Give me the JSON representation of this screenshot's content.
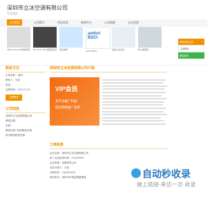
{
  "header": {
    "title": "深圳市立冰空调有限公司",
    "subtitle": "今天您好"
  },
  "nav": {
    "items": [
      "公司首页",
      "公司简介",
      "供应信息",
      "新闻中心",
      "公司相册",
      "企业资质"
    ],
    "active_index": 0
  },
  "thumbs": [
    {
      "caption": "GB0-VC6-2H4A管线风机"
    },
    {
      "caption": "HD-VC3-T43A无阻尼空调"
    },
    {
      "caption": "安全编号"
    },
    {
      "caption": "amfori BSCI"
    },
    {
      "caption": "某某认证证书"
    },
    {
      "caption": "防火阀安装"
    }
  ],
  "sidebar": {
    "contact_title": "联系方式",
    "lines": [
      "公司名称：深圳...",
      "联系人：王经",
      "电话：",
      "注册时间：2012-01-26"
    ],
    "button": "立即联系",
    "products_title": "公司动态",
    "product_lines": [
      "深圳市立冰空调有限公司",
      "精密空调",
      "空调",
      "精密空调 / 机房精密空调",
      "风冷精密机房空调"
    ]
  },
  "main": {
    "intro_title": "深圳市立冰空调有限公司介绍",
    "vip": {
      "title": "VIP会员",
      "line1": "多平台推广利器",
      "line2": "提高网络推广效率"
    },
    "info_title": "工商信息",
    "info_rows": [
      "企业名称：深圳市立冰空调有限公司",
      "统一社会信用代码：914403005...",
      "企业类型：有限责任公司",
      "法定代表人：王某",
      "注册资本：人民币100万",
      "登记机关：深圳市市场监督管理局"
    ]
  },
  "right_panel": {
    "title": "手机访问公司",
    "item1": "立即联系",
    "item2": "微信咨询"
  },
  "watermark": {
    "title": "自动秒收录",
    "slogan": "做上链接·来访一次·收录"
  },
  "colors": {
    "accent": "#f29100",
    "vip": "#f46a10",
    "green": "#3bb54a",
    "blue": "#2f7cc0"
  }
}
